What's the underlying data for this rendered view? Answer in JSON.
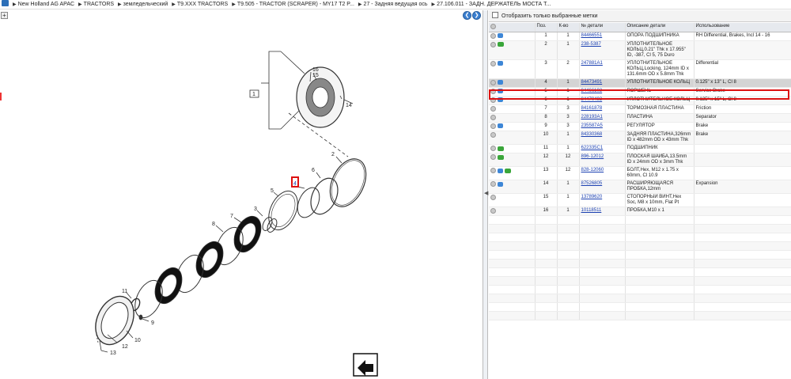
{
  "breadcrumb": {
    "items": [
      "New Holland AG APAC",
      "TRACTORS",
      "земледельческий",
      "T9.XXX TRACTORS",
      "T9.505 - TRACTOR (SCRAPER) - MY17 T2 P...",
      "27 - Задняя ведущая ось",
      "27.106.011 - ЗАДН. ДЕРЖАТЕЛЬ МОСТА Т..."
    ]
  },
  "drawing": {
    "callouts": [
      "1",
      "2",
      "3",
      "4",
      "5",
      "6",
      "7",
      "8",
      "9",
      "10",
      "11",
      "12",
      "13",
      "14",
      "15",
      "16"
    ]
  },
  "filter": {
    "label": "Отобразить только выбранные метки"
  },
  "table": {
    "headers": {
      "pos": "Поз.",
      "qty": "К-во",
      "part": "№ детали",
      "desc": "Описание детали",
      "usage": "Использование"
    },
    "rows": [
      {
        "pos": "1",
        "qty": "1",
        "part": "84466551",
        "desc": "ОПОРА ПОДШИПНИКА",
        "usage": "RH Differential, Brakes, Incl 14 - 16",
        "icons": [
          "grey",
          "blue"
        ]
      },
      {
        "pos": "2",
        "qty": "1",
        "part": "238-5387",
        "desc": "УПЛОТНИТЕЛЬНОЕ КОЛЬЦ,0.21\" Thk x 17.955\" ID, -387, Cl 5, 75 Duro",
        "usage": "",
        "icons": [
          "grey",
          "green"
        ]
      },
      {
        "pos": "3",
        "qty": "2",
        "part": "247881A1",
        "desc": "УПЛОТНИТЕЛЬНОЕ КОЛЬЦ,Locking, 124mm ID x 131.6mm OD x 5.8mm Thk",
        "usage": "Differential",
        "icons": [
          "grey",
          "blue"
        ]
      },
      {
        "pos": "4",
        "qty": "1",
        "part": "84473491",
        "desc": "УПЛОТНИТЕЛЬНОЕ КОЛЬЦ",
        "usage": "0.125\" x 13\" L, Cl 8",
        "icons": [
          "grey",
          "blue"
        ],
        "selected": true
      },
      {
        "pos": "5",
        "qty": "1",
        "part": "84466102",
        "desc": "ПОРШЕНЬ",
        "usage": "Service Brake",
        "icons": [
          "grey",
          "blue"
        ]
      },
      {
        "pos": "6",
        "qty": "1",
        "part": "84470492",
        "desc": "УПЛОТНИТЕЛЬНОЕ КОЛЬЦ",
        "usage": "0.125\" x 15\" L, Cl 8",
        "icons": [
          "grey",
          "blue"
        ]
      },
      {
        "pos": "7",
        "qty": "3",
        "part": "84161878",
        "desc": "ТОРМОЗНАЯ ПЛАСТИНА",
        "usage": "Friction",
        "icons": [
          "grey"
        ]
      },
      {
        "pos": "8",
        "qty": "3",
        "part": "228193A1",
        "desc": "ПЛАСТИНА",
        "usage": "Separator",
        "icons": [
          "grey"
        ]
      },
      {
        "pos": "9",
        "qty": "3",
        "part": "235587A5",
        "desc": "РЕГУЛЯТОР",
        "usage": "Brake",
        "icons": [
          "grey",
          "blue"
        ]
      },
      {
        "pos": "10",
        "qty": "1",
        "part": "84330368",
        "desc": "ЗАДНЯЯ ПЛАСТИНА,326mm ID x 482mm OD x 43mm Thk",
        "usage": "Brake",
        "icons": [
          "grey"
        ]
      },
      {
        "pos": "11",
        "qty": "1",
        "part": "622335C1",
        "desc": "ПОДШИПНИК",
        "usage": "",
        "icons": [
          "grey",
          "green"
        ]
      },
      {
        "pos": "12",
        "qty": "12",
        "part": "896-12012",
        "desc": "ПЛОСКАЯ ШАЙБА,13.5mm ID x 24mm OD x 3mm Thk",
        "usage": "",
        "icons": [
          "grey",
          "green"
        ]
      },
      {
        "pos": "13",
        "qty": "12",
        "part": "828-12060",
        "desc": "БОЛТ,Hex, M12 x 1.75 x 60mm, Cl 10.9",
        "usage": "",
        "icons": [
          "grey",
          "blue",
          "green"
        ]
      },
      {
        "pos": "14",
        "qty": "1",
        "part": "87526805",
        "desc": "РАСШИРЯЮЩАЯСЯ ПРОБКА,12mm",
        "usage": "Expansion",
        "icons": [
          "grey",
          "blue"
        ]
      },
      {
        "pos": "15",
        "qty": "1",
        "part": "13789620",
        "desc": "СТОПОРНЫЙ ВИНТ,Hex Soc, M8 x 10mm, Flat Pt",
        "usage": "",
        "icons": [
          "grey"
        ]
      },
      {
        "pos": "16",
        "qty": "1",
        "part": "10118511",
        "desc": "ПРОБКА,M10 x 1",
        "usage": "",
        "icons": [
          "grey"
        ]
      }
    ]
  }
}
